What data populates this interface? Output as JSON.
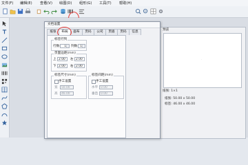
{
  "menubar": {
    "items": [
      "文件(F)",
      "编辑(E)",
      "查看(V)",
      "绘图(D)",
      "组形(G)",
      "工具(T)",
      "帮助(H)"
    ]
  },
  "toolbar": {
    "icons": [
      "new-icon",
      "open-icon",
      "save-icon",
      "print-icon",
      "paste-icon",
      "undo-icon",
      "redo-icon",
      "database-icon",
      "barcode-icon",
      "align-icon",
      "zoom-in-icon",
      "zoom-out-icon",
      "grid-icon",
      "settings-icon"
    ]
  },
  "dialog": {
    "title": "文档设置",
    "tabs": [
      "纸张",
      "布局",
      "画布",
      "页码",
      "公司",
      "页眉",
      "页码",
      "信息"
    ],
    "active_tab": "布局",
    "layout": {
      "rows_cols": {
        "title": "标签行列",
        "rows_label": "行数:",
        "rows_value": "1",
        "cols_label": "列数:",
        "cols_value": "1"
      },
      "margins": {
        "title": "页面边距(mm)",
        "top_label": "上",
        "top_value": "2.00",
        "left_label": "左",
        "left_value": "2.00",
        "bottom_label": "下",
        "bottom_value": "2.00",
        "right_label": "右",
        "right_value": "2.00"
      },
      "label_size": {
        "title": "标签尺寸(mm)",
        "manual_label": "手工设置",
        "width_label": "宽",
        "width_value": "50.00",
        "height_label": "高",
        "height_value": "46.00"
      },
      "label_spacing": {
        "title": "标签间距(mm)",
        "manual_label": "手工设置",
        "h_label": "水平",
        "h_value": "0.00",
        "v_label": "垂直",
        "v_value": "0.00"
      }
    }
  },
  "preview": {
    "title": "预览",
    "grid_label": "纸张: 1×1",
    "size_text": "纸张: 50.00 x 50.00",
    "label_text": "标签: 46.00 x 46.00"
  },
  "colors": {
    "highlight": "#e53935",
    "accent": "#2f6fc9"
  }
}
